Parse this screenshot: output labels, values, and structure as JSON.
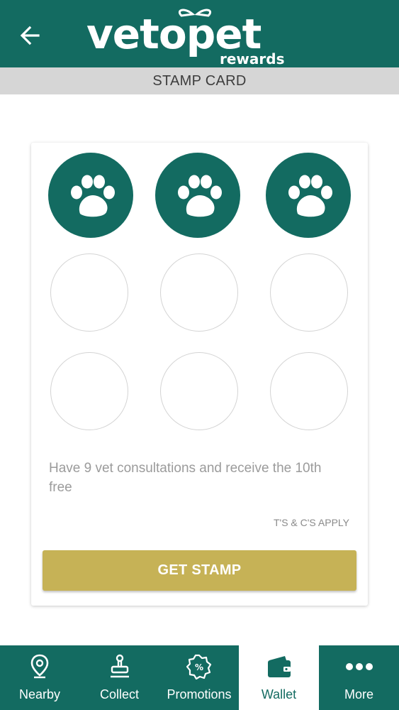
{
  "header": {
    "logo_main": "vetopet",
    "logo_sub": "rewards",
    "colors": {
      "brand": "#136b61",
      "accent": "#c6b256"
    }
  },
  "page": {
    "title": "STAMP CARD"
  },
  "stamp_card": {
    "total_stamps": 9,
    "collected_stamps": 3,
    "stamp_icon": "paw-icon",
    "offer_text": "Have 9 vet consultations and receive the 10th free",
    "terms": "T'S & C'S APPLY",
    "button_label": "GET STAMP"
  },
  "nav": {
    "items": [
      {
        "label": "Nearby",
        "icon": "location-pin-icon",
        "active": false
      },
      {
        "label": "Collect",
        "icon": "stamp-icon",
        "active": false
      },
      {
        "label": "Promotions",
        "icon": "promotion-badge-icon",
        "active": false
      },
      {
        "label": "Wallet",
        "icon": "wallet-icon",
        "active": true
      },
      {
        "label": "More",
        "icon": "more-dots-icon",
        "active": false
      }
    ]
  }
}
